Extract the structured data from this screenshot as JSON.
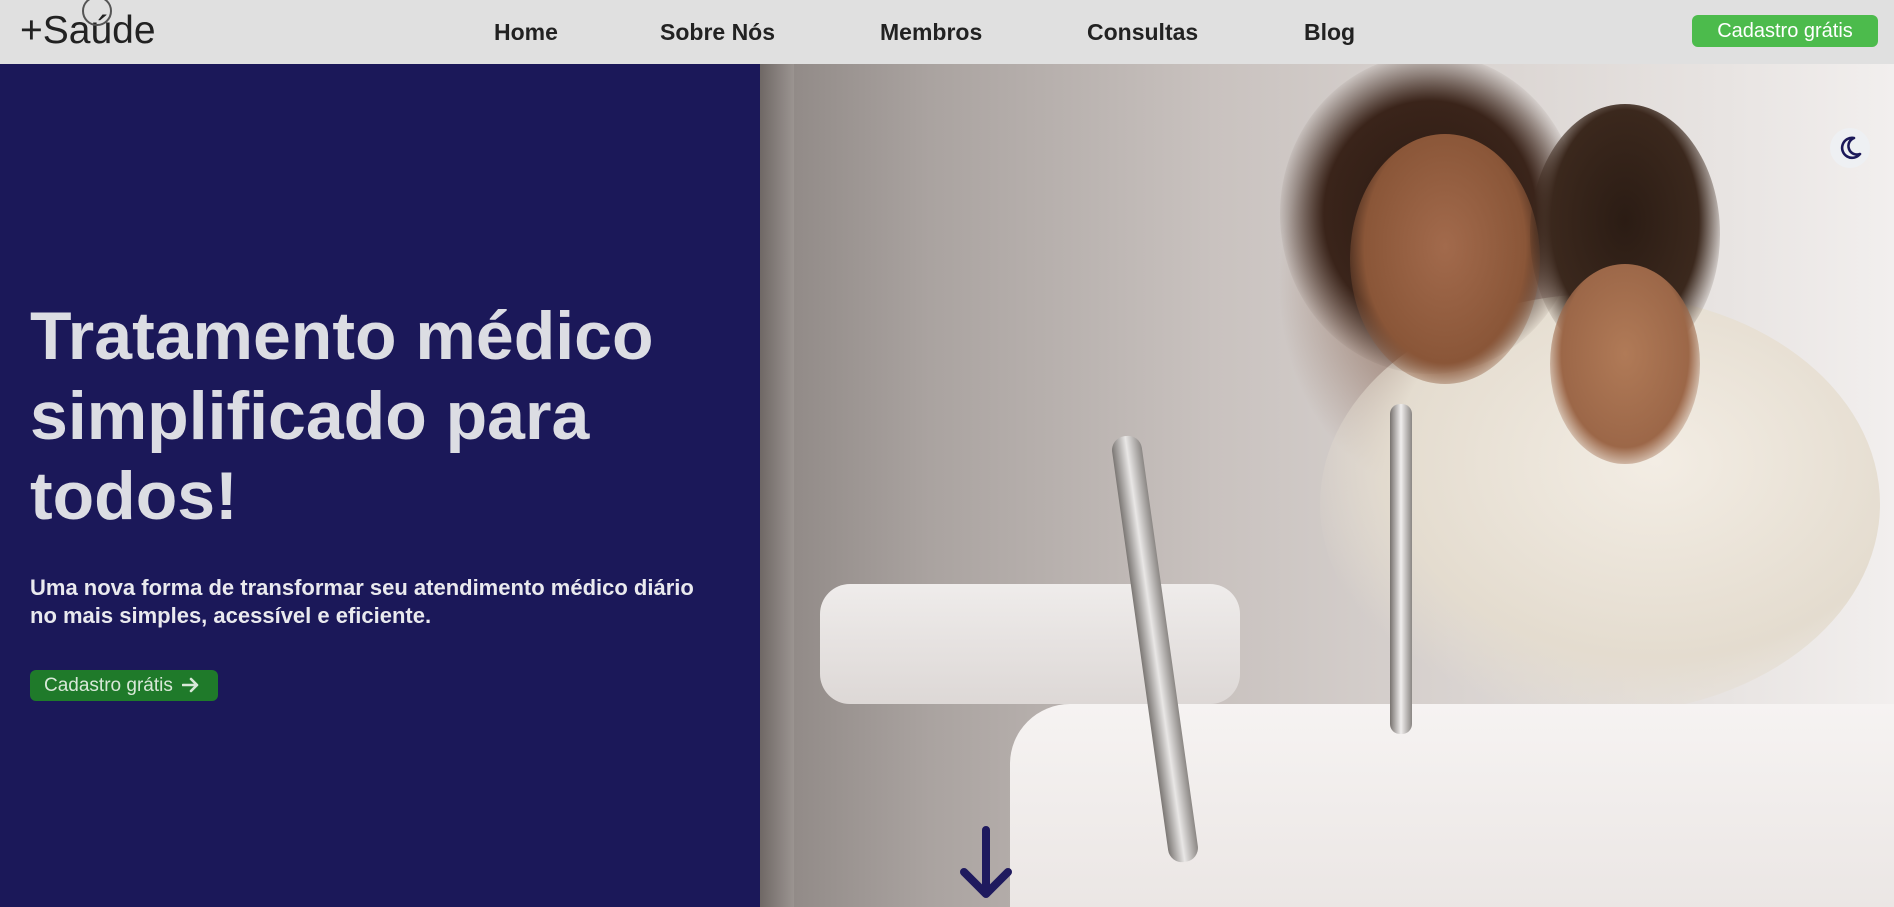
{
  "header": {
    "logo": "+Saúde",
    "nav": [
      {
        "label": "Home"
      },
      {
        "label": "Sobre Nós"
      },
      {
        "label": "Membros"
      },
      {
        "label": "Consultas"
      },
      {
        "label": "Blog"
      }
    ],
    "cta_label": "Cadastro grátis"
  },
  "hero": {
    "title": "Tratamento médico simplificado para todos!",
    "subtitle": "Uma nova forma de transformar seu atendimento médico diário no mais simples, acessível e eficiente.",
    "cta_label": "Cadastro grátis",
    "cta_icon": "arrow-right-icon",
    "image_alt": "hero-photo"
  },
  "icons": {
    "theme_toggle": "moon-icon",
    "scroll_down": "arrow-down-icon"
  },
  "colors": {
    "header_bg": "#e0e0e0",
    "hero_bg": "#1b1859",
    "cta_green": "#4cbb4c",
    "hero_cta_green": "#1f7a2a"
  }
}
